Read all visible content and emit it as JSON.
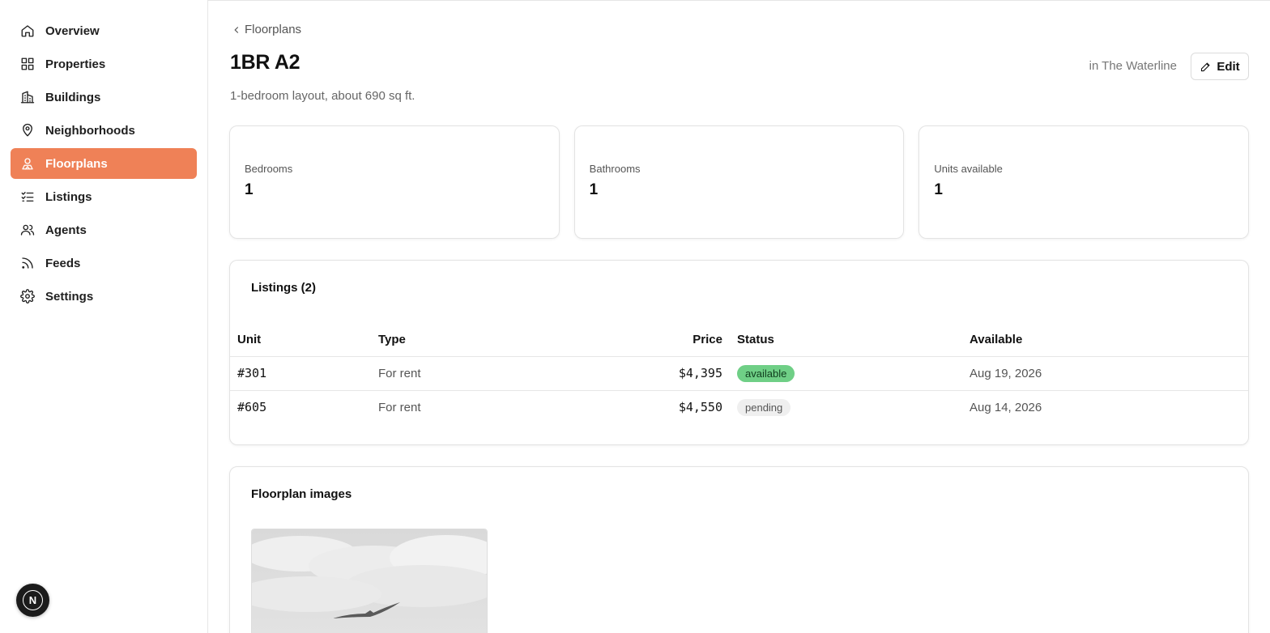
{
  "sidebar": {
    "items": [
      {
        "label": "Overview",
        "icon": "home-icon"
      },
      {
        "label": "Properties",
        "icon": "grid-icon"
      },
      {
        "label": "Buildings",
        "icon": "building-icon"
      },
      {
        "label": "Neighborhoods",
        "icon": "map-pin-icon"
      },
      {
        "label": "Floorplans",
        "icon": "floorplan-icon",
        "active": true
      },
      {
        "label": "Listings",
        "icon": "list-checks-icon"
      },
      {
        "label": "Agents",
        "icon": "users-icon"
      },
      {
        "label": "Feeds",
        "icon": "rss-icon"
      },
      {
        "label": "Settings",
        "icon": "gear-icon"
      }
    ],
    "badge": "N"
  },
  "header": {
    "breadcrumb": "Floorplans",
    "title": "1BR A2",
    "subtitle": "1-bedroom layout, about 690 sq ft.",
    "building": "in The Waterline",
    "edit_label": "Edit"
  },
  "stats": [
    {
      "label": "Bedrooms",
      "value": "1"
    },
    {
      "label": "Bathrooms",
      "value": "1"
    },
    {
      "label": "Units available",
      "value": "1"
    }
  ],
  "listings": {
    "title": "Listings (2)",
    "columns": [
      "Unit",
      "Type",
      "Price",
      "Status",
      "Available"
    ],
    "rows": [
      {
        "unit": "#301",
        "type": "For rent",
        "price": "$4,395",
        "status": "available",
        "available": "Aug 19, 2026"
      },
      {
        "unit": "#605",
        "type": "For rent",
        "price": "$4,550",
        "status": "pending",
        "available": "Aug 14, 2026"
      }
    ]
  },
  "images": {
    "title": "Floorplan images"
  },
  "colors": {
    "accent": "#ef8157",
    "status_available": "#6fcf86",
    "status_pending": "#efefef"
  }
}
